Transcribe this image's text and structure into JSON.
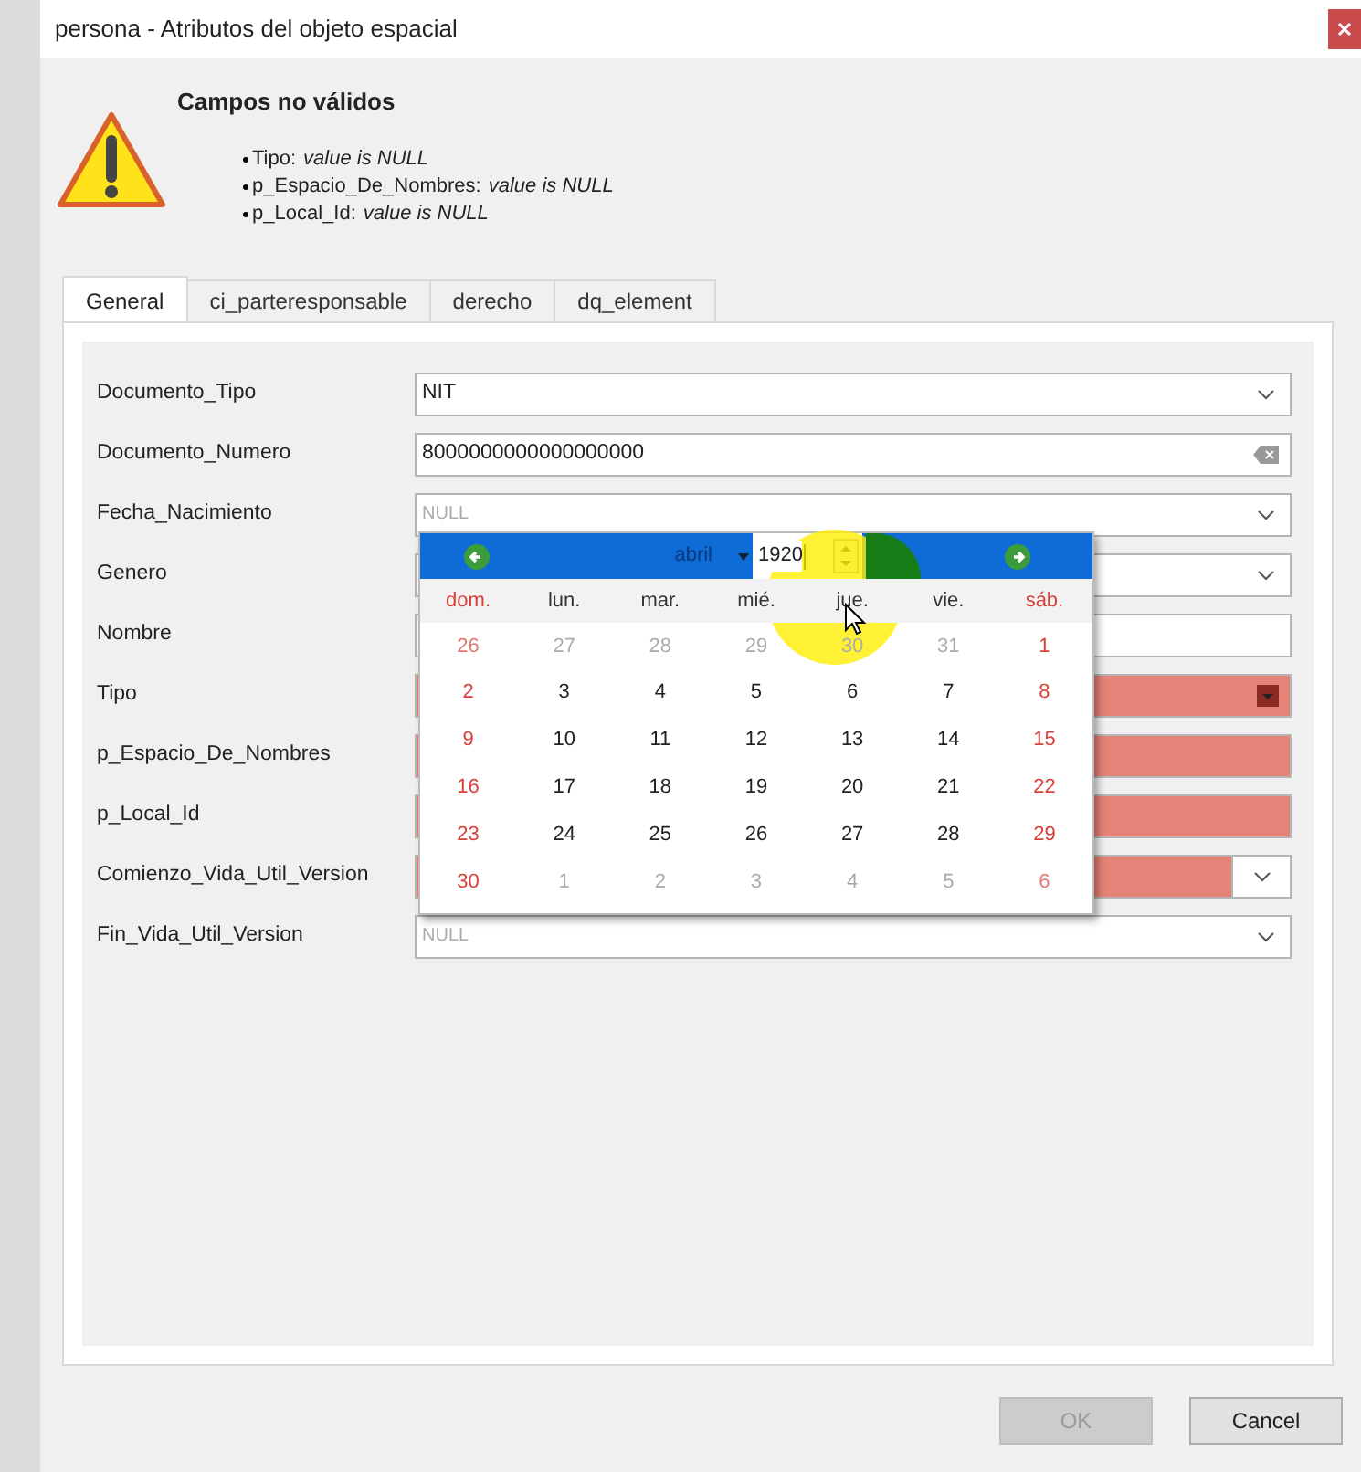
{
  "window": {
    "title": "persona - Atributos del objeto espacial"
  },
  "warning": {
    "title": "Campos no válidos",
    "items": [
      {
        "field": "Tipo:",
        "message": "value is NULL"
      },
      {
        "field": "p_Espacio_De_Nombres:",
        "message": "value is NULL"
      },
      {
        "field": "p_Local_Id:",
        "message": "value is NULL"
      }
    ]
  },
  "tabs": [
    {
      "label": "General",
      "selected": true
    },
    {
      "label": "ci_parteresponsable",
      "selected": false
    },
    {
      "label": "derecho",
      "selected": false
    },
    {
      "label": "dq_element",
      "selected": false
    }
  ],
  "fields": [
    {
      "label": "Documento_Tipo",
      "kind": "combo",
      "value": "NIT",
      "invalid": false
    },
    {
      "label": "Documento_Numero",
      "kind": "text-clear",
      "value": "8000000000000000000",
      "invalid": false
    },
    {
      "label": "Fecha_Nacimiento",
      "kind": "date",
      "placeholder": "NULL",
      "invalid": false
    },
    {
      "label": "Genero",
      "kind": "combo",
      "invalid": false
    },
    {
      "label": "Nombre",
      "kind": "text",
      "invalid": false
    },
    {
      "label": "Tipo",
      "kind": "combo",
      "invalid": true
    },
    {
      "label": "p_Espacio_De_Nombres",
      "kind": "text",
      "invalid": true
    },
    {
      "label": "p_Local_Id",
      "kind": "text",
      "invalid": true
    },
    {
      "label": "Comienzo_Vida_Util_Version",
      "kind": "date",
      "invalid": true
    },
    {
      "label": "Fin_Vida_Util_Version",
      "kind": "date",
      "placeholder": "NULL",
      "invalid": false
    }
  ],
  "calendar": {
    "month": "abril",
    "year": "1920",
    "weekdays": [
      "dom.",
      "lun.",
      "mar.",
      "mié.",
      "jue.",
      "vie.",
      "sáb."
    ],
    "weeks": [
      [
        {
          "day": "26",
          "other_month": true
        },
        {
          "day": "27",
          "other_month": true
        },
        {
          "day": "28",
          "other_month": true
        },
        {
          "day": "29",
          "other_month": true
        },
        {
          "day": "30",
          "other_month": true
        },
        {
          "day": "31",
          "other_month": true
        },
        {
          "day": "1",
          "other_month": false
        }
      ],
      [
        {
          "day": "2",
          "other_month": false
        },
        {
          "day": "3",
          "other_month": false
        },
        {
          "day": "4",
          "other_month": false
        },
        {
          "day": "5",
          "other_month": false
        },
        {
          "day": "6",
          "other_month": false
        },
        {
          "day": "7",
          "other_month": false
        },
        {
          "day": "8",
          "other_month": false
        }
      ],
      [
        {
          "day": "9",
          "other_month": false
        },
        {
          "day": "10",
          "other_month": false
        },
        {
          "day": "11",
          "other_month": false
        },
        {
          "day": "12",
          "other_month": false
        },
        {
          "day": "13",
          "other_month": false
        },
        {
          "day": "14",
          "other_month": false
        },
        {
          "day": "15",
          "other_month": false
        }
      ],
      [
        {
          "day": "16",
          "other_month": false
        },
        {
          "day": "17",
          "other_month": false
        },
        {
          "day": "18",
          "other_month": false
        },
        {
          "day": "19",
          "other_month": false
        },
        {
          "day": "20",
          "other_month": false
        },
        {
          "day": "21",
          "other_month": false
        },
        {
          "day": "22",
          "other_month": false
        }
      ],
      [
        {
          "day": "23",
          "other_month": false
        },
        {
          "day": "24",
          "other_month": false
        },
        {
          "day": "25",
          "other_month": false
        },
        {
          "day": "26",
          "other_month": false
        },
        {
          "day": "27",
          "other_month": false
        },
        {
          "day": "28",
          "other_month": false
        },
        {
          "day": "29",
          "other_month": false
        }
      ],
      [
        {
          "day": "30",
          "other_month": false
        },
        {
          "day": "1",
          "other_month": true
        },
        {
          "day": "2",
          "other_month": true
        },
        {
          "day": "3",
          "other_month": true
        },
        {
          "day": "4",
          "other_month": true
        },
        {
          "day": "5",
          "other_month": true
        },
        {
          "day": "6",
          "other_month": true
        }
      ]
    ]
  },
  "buttons": [
    {
      "label": "OK",
      "disabled": true
    },
    {
      "label": "Cancel",
      "disabled": false
    }
  ]
}
